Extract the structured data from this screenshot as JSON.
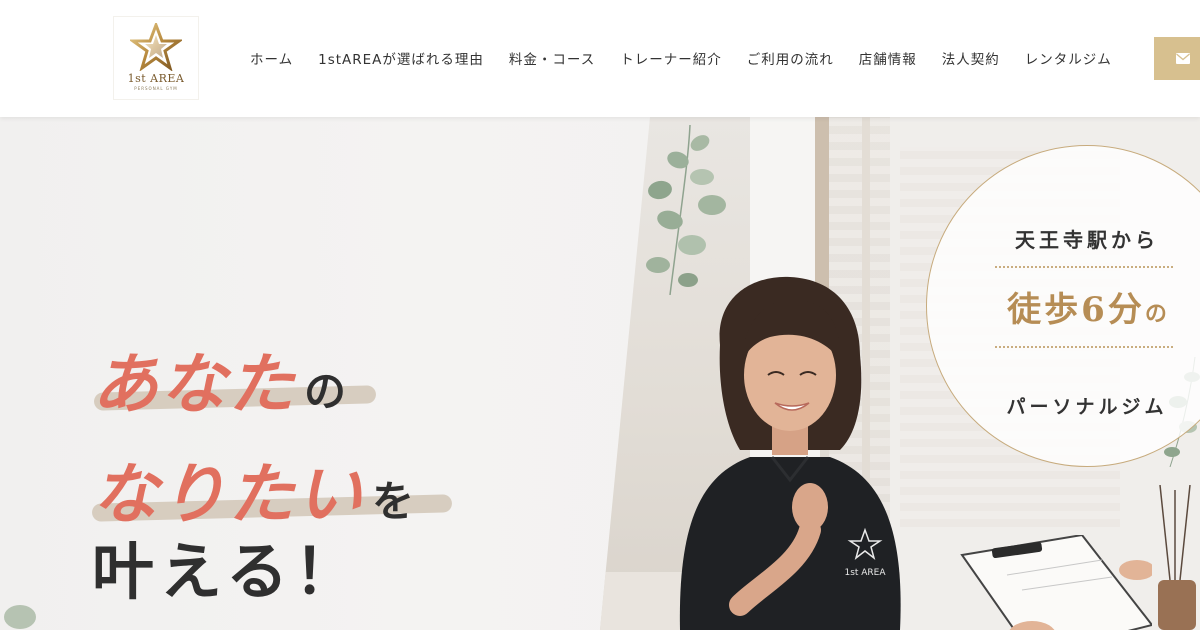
{
  "header": {
    "logo": {
      "name": "1st AREA",
      "sub": "PERSONAL GYM",
      "icon": "star-logo-icon"
    },
    "nav": [
      {
        "label": "ホーム"
      },
      {
        "label": "1stAREAが選ばれる理由"
      },
      {
        "label": "料金・コース"
      },
      {
        "label": "トレーナー紹介"
      },
      {
        "label": "ご利用の流れ"
      },
      {
        "label": "店舗情報"
      },
      {
        "label": "法人契約"
      },
      {
        "label": "レンタルジム"
      }
    ],
    "mail_button": {
      "icon": "envelope-icon"
    }
  },
  "hero": {
    "headline": {
      "line1_accent": "あなた",
      "line1_tail": "の",
      "line2_accent": "なりたい",
      "line2_tail": "を",
      "line3": "叶える！"
    },
    "badge": {
      "line1": "天王寺駅から",
      "line2_main": "徒歩6分",
      "line2_tail": "の",
      "line3": "パーソナルジム"
    },
    "shirt_logo": "1st AREA"
  },
  "colors": {
    "accent_coral": "#e1705f",
    "gold": "#d7c08f",
    "badge_gold": "#b68d55",
    "text_dark": "#333333"
  }
}
